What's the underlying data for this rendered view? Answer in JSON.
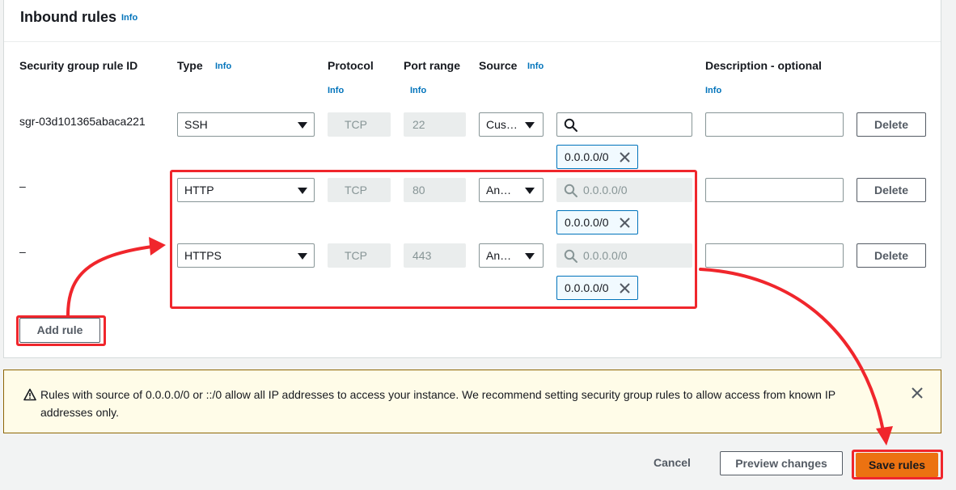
{
  "header": {
    "title": "Inbound rules",
    "info": "Info"
  },
  "columns": {
    "rule_id": "Security group rule ID",
    "type": "Type",
    "type_info": "Info",
    "protocol": "Protocol",
    "protocol_info": "Info",
    "port_range": "Port range",
    "port_info": "Info",
    "source": "Source",
    "source_info": "Info",
    "description": "Description - optional",
    "description_info": "Info"
  },
  "rules": [
    {
      "id": "sgr-03d101365abaca221",
      "type": "SSH",
      "protocol": "TCP",
      "port": "22",
      "source": "Cus…",
      "search_placeholder": "",
      "search_disabled": false,
      "cidr": "0.0.0.0/0",
      "description": "",
      "delete_label": "Delete"
    },
    {
      "id": "–",
      "type": "HTTP",
      "protocol": "TCP",
      "port": "80",
      "source": "An…",
      "search_placeholder": "0.0.0.0/0",
      "search_disabled": true,
      "cidr": "0.0.0.0/0",
      "description": "",
      "delete_label": "Delete"
    },
    {
      "id": "–",
      "type": "HTTPS",
      "protocol": "TCP",
      "port": "443",
      "source": "An…",
      "search_placeholder": "0.0.0.0/0",
      "search_disabled": true,
      "cidr": "0.0.0.0/0",
      "description": "",
      "delete_label": "Delete"
    }
  ],
  "add_rule_label": "Add rule",
  "alert": {
    "icon": "warning-icon",
    "message": "Rules with source of 0.0.0.0/0 or ::/0 allow all IP addresses to access your instance. We recommend setting security group rules to allow access from known IP addresses only."
  },
  "footer": {
    "cancel_label": "Cancel",
    "preview_label": "Preview changes",
    "save_label": "Save rules"
  },
  "colors": {
    "accent": "#0073bb",
    "primary_button": "#ec7211",
    "annotation": "#f0262c",
    "alert_background": "#fffce8"
  }
}
